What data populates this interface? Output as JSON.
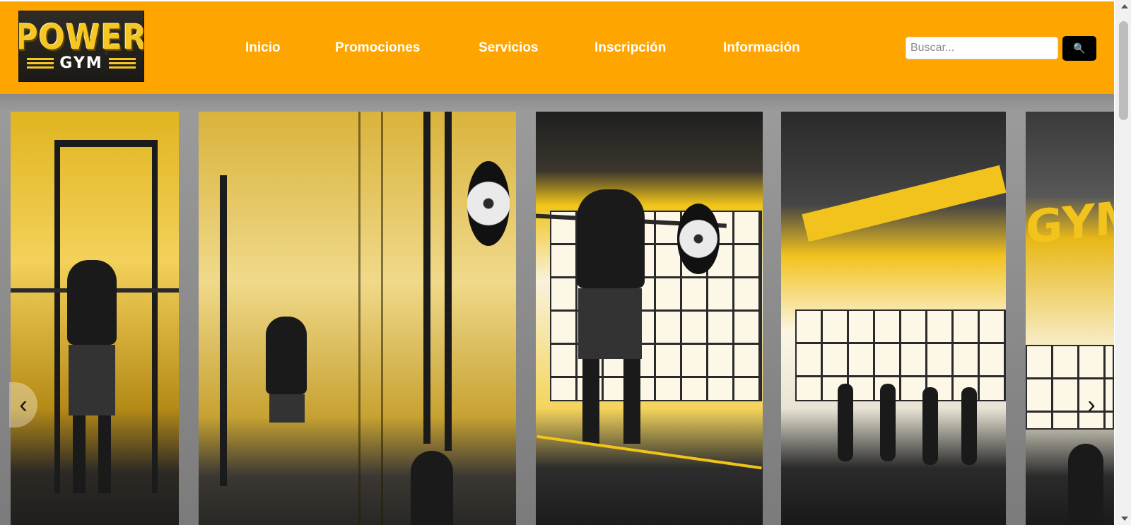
{
  "brand": {
    "logo_main": "POWER",
    "logo_sub": "GYM"
  },
  "nav": {
    "items": [
      {
        "label": "Inicio"
      },
      {
        "label": "Promociones"
      },
      {
        "label": "Servicios"
      },
      {
        "label": "Inscripción"
      },
      {
        "label": "Información"
      }
    ]
  },
  "search": {
    "placeholder": "Buscar...",
    "value": "",
    "button_icon": "search-icon",
    "button_glyph": "🔍"
  },
  "hero": {
    "prev_glyph": "‹",
    "next_glyph": "›",
    "wall_text": "GYM"
  },
  "colors": {
    "header_bg": "#ffa500",
    "accent": "#f2c21d",
    "search_button_bg": "#000000"
  }
}
